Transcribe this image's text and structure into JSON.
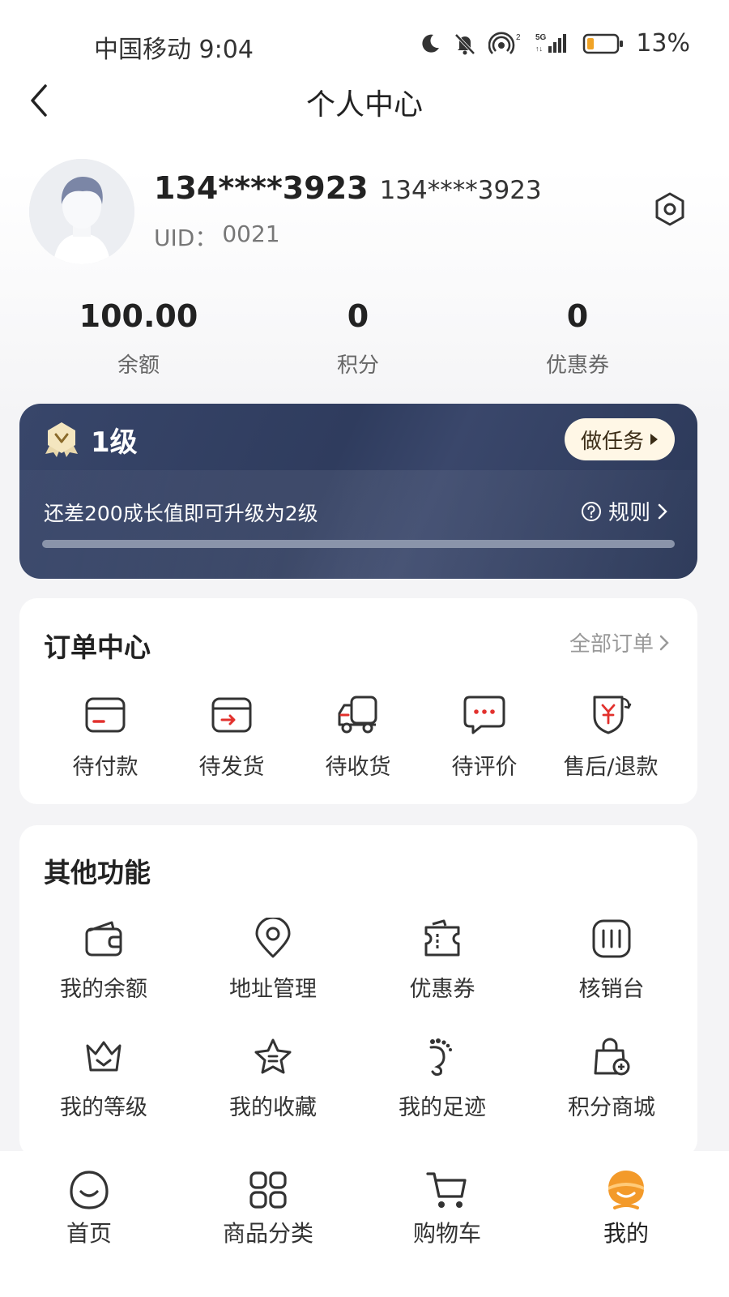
{
  "status_bar": {
    "carrier_time": "中国移动 9:04",
    "battery": "13%"
  },
  "nav": {
    "title": "个人中心"
  },
  "profile": {
    "name": "134****3923",
    "name_secondary": "134****3923",
    "uid_label": "UID：",
    "uid": "0021"
  },
  "stats": [
    {
      "value": "100.00",
      "label": "余额"
    },
    {
      "value": "0",
      "label": "积分"
    },
    {
      "value": "0",
      "label": "优惠券"
    }
  ],
  "level": {
    "label": "1级",
    "task_button": "做任务",
    "hint": "还差200成长值即可升级为2级",
    "rule": "规则",
    "progress_fraction": 0.0
  },
  "orders": {
    "title": "订单中心",
    "all_link": "全部订单",
    "items": [
      {
        "label": "待付款",
        "icon": "wallet-card-icon"
      },
      {
        "label": "待发货",
        "icon": "package-send-icon"
      },
      {
        "label": "待收货",
        "icon": "truck-icon"
      },
      {
        "label": "待评价",
        "icon": "comment-icon"
      },
      {
        "label": "售后/退款",
        "icon": "refund-icon"
      }
    ]
  },
  "functions": {
    "title": "其他功能",
    "items": [
      {
        "label": "我的余额",
        "icon": "wallet-icon"
      },
      {
        "label": "地址管理",
        "icon": "location-pin-icon"
      },
      {
        "label": "优惠券",
        "icon": "coupon-icon"
      },
      {
        "label": "核销台",
        "icon": "scan-verify-icon"
      },
      {
        "label": "我的等级",
        "icon": "crown-icon"
      },
      {
        "label": "我的收藏",
        "icon": "star-icon"
      },
      {
        "label": "我的足迹",
        "icon": "footprint-icon"
      },
      {
        "label": "积分商城",
        "icon": "shopping-bag-icon"
      }
    ]
  },
  "bottom_nav": [
    {
      "label": "首页",
      "icon": "home-face-icon",
      "active": false
    },
    {
      "label": "商品分类",
      "icon": "category-grid-icon",
      "active": false
    },
    {
      "label": "购物车",
      "icon": "cart-icon",
      "active": false
    },
    {
      "label": "我的",
      "icon": "profile-icon",
      "active": true
    }
  ],
  "colors": {
    "accent": "#f39a2a",
    "level_card": "#303d5f",
    "order_red": "#e2312d"
  }
}
